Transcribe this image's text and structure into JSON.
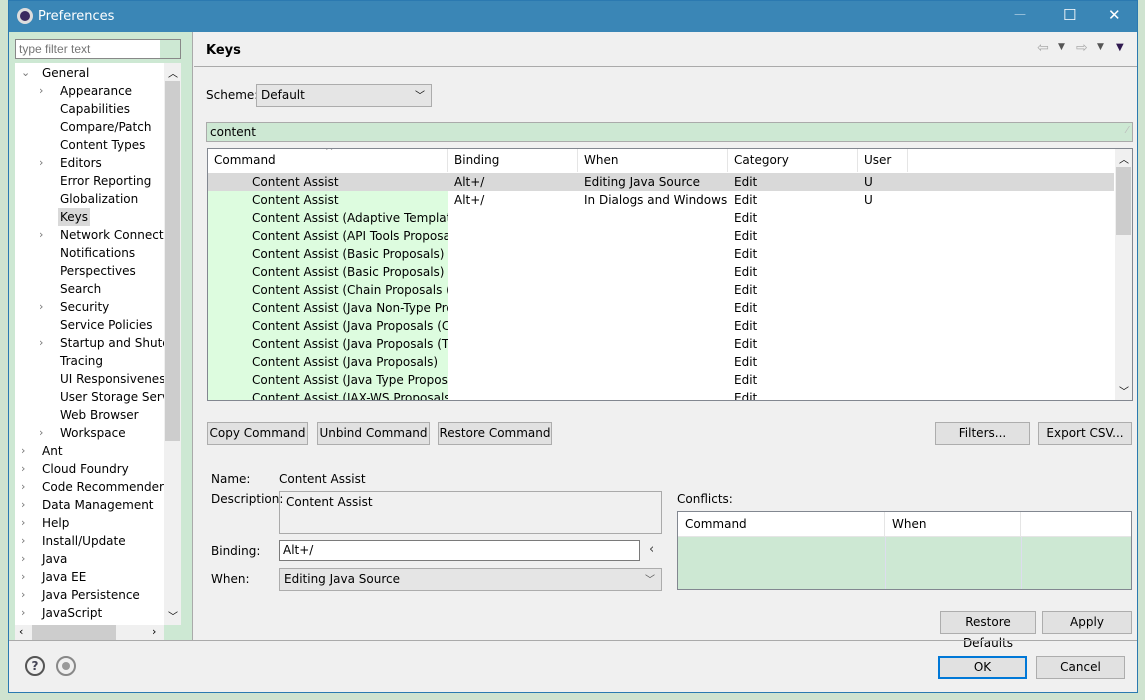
{
  "window": {
    "title": "Preferences",
    "minimize": "—",
    "maximize": "☐",
    "close": "✕"
  },
  "sidebar": {
    "filter_placeholder": "type filter text",
    "items": [
      {
        "label": "General",
        "level": 0,
        "expander": "open"
      },
      {
        "label": "Appearance",
        "level": 1,
        "expander": "closed"
      },
      {
        "label": "Capabilities",
        "level": 1,
        "expander": ""
      },
      {
        "label": "Compare/Patch",
        "level": 1,
        "expander": ""
      },
      {
        "label": "Content Types",
        "level": 1,
        "expander": ""
      },
      {
        "label": "Editors",
        "level": 1,
        "expander": "closed"
      },
      {
        "label": "Error Reporting",
        "level": 1,
        "expander": ""
      },
      {
        "label": "Globalization",
        "level": 1,
        "expander": ""
      },
      {
        "label": "Keys",
        "level": 1,
        "expander": "",
        "selected": true
      },
      {
        "label": "Network Connections",
        "level": 1,
        "expander": "closed"
      },
      {
        "label": "Notifications",
        "level": 1,
        "expander": ""
      },
      {
        "label": "Perspectives",
        "level": 1,
        "expander": ""
      },
      {
        "label": "Search",
        "level": 1,
        "expander": ""
      },
      {
        "label": "Security",
        "level": 1,
        "expander": "closed"
      },
      {
        "label": "Service Policies",
        "level": 1,
        "expander": ""
      },
      {
        "label": "Startup and Shutdown",
        "level": 1,
        "expander": "closed"
      },
      {
        "label": "Tracing",
        "level": 1,
        "expander": ""
      },
      {
        "label": "UI Responsiveness Monitoring",
        "level": 1,
        "expander": ""
      },
      {
        "label": "User Storage Service",
        "level": 1,
        "expander": ""
      },
      {
        "label": "Web Browser",
        "level": 1,
        "expander": ""
      },
      {
        "label": "Workspace",
        "level": 1,
        "expander": "closed"
      },
      {
        "label": "Ant",
        "level": 0,
        "expander": "closed"
      },
      {
        "label": "Cloud Foundry",
        "level": 0,
        "expander": "closed"
      },
      {
        "label": "Code Recommenders",
        "level": 0,
        "expander": "closed"
      },
      {
        "label": "Data Management",
        "level": 0,
        "expander": "closed"
      },
      {
        "label": "Help",
        "level": 0,
        "expander": "closed"
      },
      {
        "label": "Install/Update",
        "level": 0,
        "expander": "closed"
      },
      {
        "label": "Java",
        "level": 0,
        "expander": "closed"
      },
      {
        "label": "Java EE",
        "level": 0,
        "expander": "closed"
      },
      {
        "label": "Java Persistence",
        "level": 0,
        "expander": "closed"
      },
      {
        "label": "JavaScript",
        "level": 0,
        "expander": "closed"
      }
    ]
  },
  "page": {
    "title": "Keys",
    "scheme_label": "Scheme:",
    "scheme_value": "Default",
    "filter_value": "content",
    "table": {
      "columns": [
        "Command",
        "Binding",
        "When",
        "Category",
        "User"
      ],
      "rows": [
        [
          "Content Assist",
          "Alt+/",
          "Editing Java Source",
          "Edit",
          "U"
        ],
        [
          "Content Assist",
          "Alt+/",
          "In Dialogs and Windows",
          "Edit",
          "U"
        ],
        [
          "Content Assist (Adaptive Template Proposals)",
          "",
          "",
          "Edit",
          ""
        ],
        [
          "Content Assist (API Tools Proposals)",
          "",
          "",
          "Edit",
          ""
        ],
        [
          "Content Assist (Basic Proposals)",
          "",
          "",
          "Edit",
          ""
        ],
        [
          "Content Assist (Basic Proposals)",
          "",
          "",
          "Edit",
          ""
        ],
        [
          "Content Assist (Chain Proposals (Code Recommenders))",
          "",
          "",
          "Edit",
          ""
        ],
        [
          "Content Assist (Java Non-Type Proposals)",
          "",
          "",
          "Edit",
          ""
        ],
        [
          "Content Assist (Java Proposals (Code Recommenders))",
          "",
          "",
          "Edit",
          ""
        ],
        [
          "Content Assist (Java Proposals (Task-Focused))",
          "",
          "",
          "Edit",
          ""
        ],
        [
          "Content Assist (Java Proposals)",
          "",
          "",
          "Edit",
          ""
        ],
        [
          "Content Assist (Java Type Proposals)",
          "",
          "",
          "Edit",
          ""
        ],
        [
          "Content Assist (JAX-WS Proposals)",
          "",
          "",
          "Edit",
          ""
        ]
      ]
    },
    "buttons": {
      "copy": "Copy Command",
      "unbind": "Unbind Command",
      "restore": "Restore Command",
      "filters": "Filters...",
      "export": "Export CSV..."
    },
    "details": {
      "name_label": "Name:",
      "name_value": "Content Assist",
      "description_label": "Description:",
      "description_value": "Content Assist",
      "binding_label": "Binding:",
      "binding_value": "Alt+/",
      "when_label": "When:",
      "when_value": "Editing Java Source"
    },
    "conflicts": {
      "label": "Conflicts:",
      "columns": [
        "Command",
        "When"
      ]
    },
    "restore_defaults": "Restore Defaults",
    "apply": "Apply"
  },
  "footer": {
    "ok": "OK",
    "cancel": "Cancel"
  }
}
